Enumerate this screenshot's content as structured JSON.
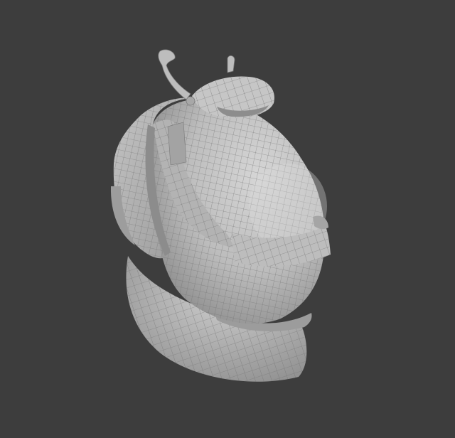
{
  "viewport": {
    "background": "#3d3d3d",
    "mesh_display": "wireframe-on-shaded",
    "object": "sculpted-creature-torso"
  },
  "colors": {
    "surface_light": "#c8c8c8",
    "surface_mid": "#a9a9a9",
    "surface_dark": "#7d7d7d",
    "wire": "#6f6f6f"
  }
}
